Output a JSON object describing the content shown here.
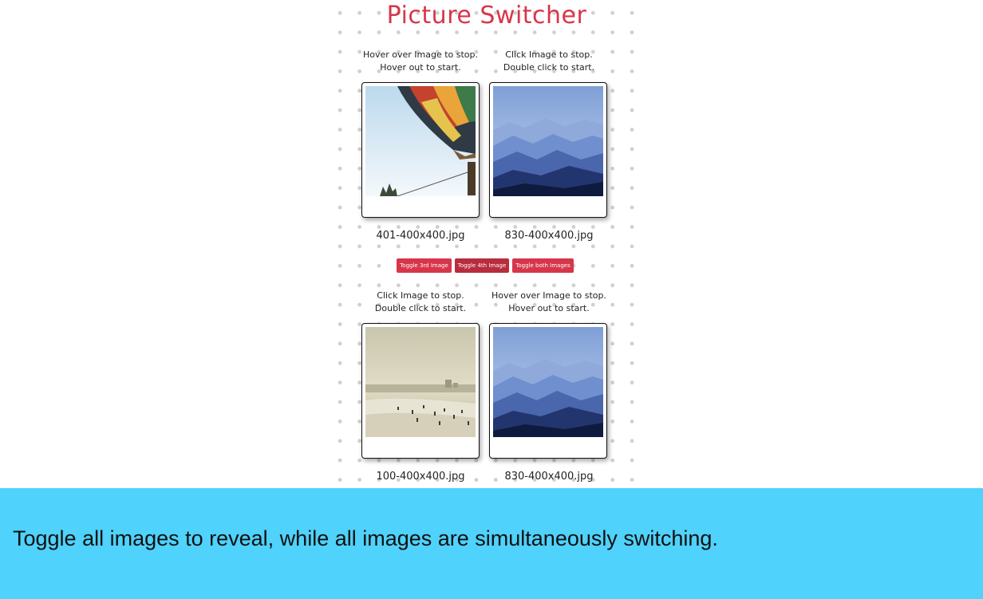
{
  "app": {
    "title": "Picture Switcher"
  },
  "cards": [
    {
      "caption": "Hover over Image to stop. Hover out to start.",
      "filename": "401-400x400.jpg",
      "image": "hot-air-balloon"
    },
    {
      "caption": "Click Image to stop. Double click to start.",
      "filename": "830-400x400.jpg",
      "image": "blue-mountains"
    },
    {
      "caption": "Click Image to stop. Double click to start.",
      "filename": "100-400x400.jpg",
      "image": "beach-scene"
    },
    {
      "caption": "Hover over Image to stop. Hover out to start.",
      "filename": "830-400x400.jpg",
      "image": "blue-mountains"
    }
  ],
  "buttons": {
    "toggle_3rd": "Toggle 3rd Image",
    "toggle_4th": "Toggle 4th Image",
    "toggle_both": "Toggle both Images"
  },
  "banner": {
    "text": "Toggle all images to reveal, while all images are simultaneously switching."
  },
  "colors": {
    "accent": "#d7364a",
    "banner": "#4fd2fb"
  }
}
